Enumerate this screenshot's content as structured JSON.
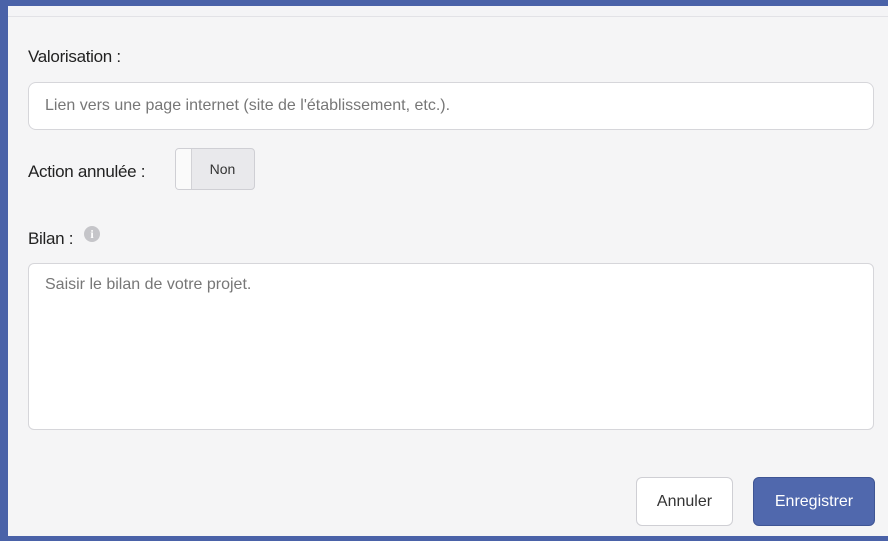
{
  "form": {
    "valorisation_label": "Valorisation :",
    "valorisation_placeholder": "Lien vers une page internet (site de l'établissement, etc.).",
    "valorisation_value": "",
    "action_annulee_label": "Action annulée :",
    "action_annulee_value": "Non",
    "bilan_label": "Bilan :",
    "bilan_info_icon": "info-icon",
    "bilan_placeholder": "Saisir le bilan de votre projet.",
    "bilan_value": ""
  },
  "actions": {
    "cancel_label": "Annuler",
    "save_label": "Enregistrer"
  },
  "colors": {
    "accent": "#4a62a8",
    "primary_button": "#5068ad",
    "panel_background": "#f5f5f6"
  }
}
